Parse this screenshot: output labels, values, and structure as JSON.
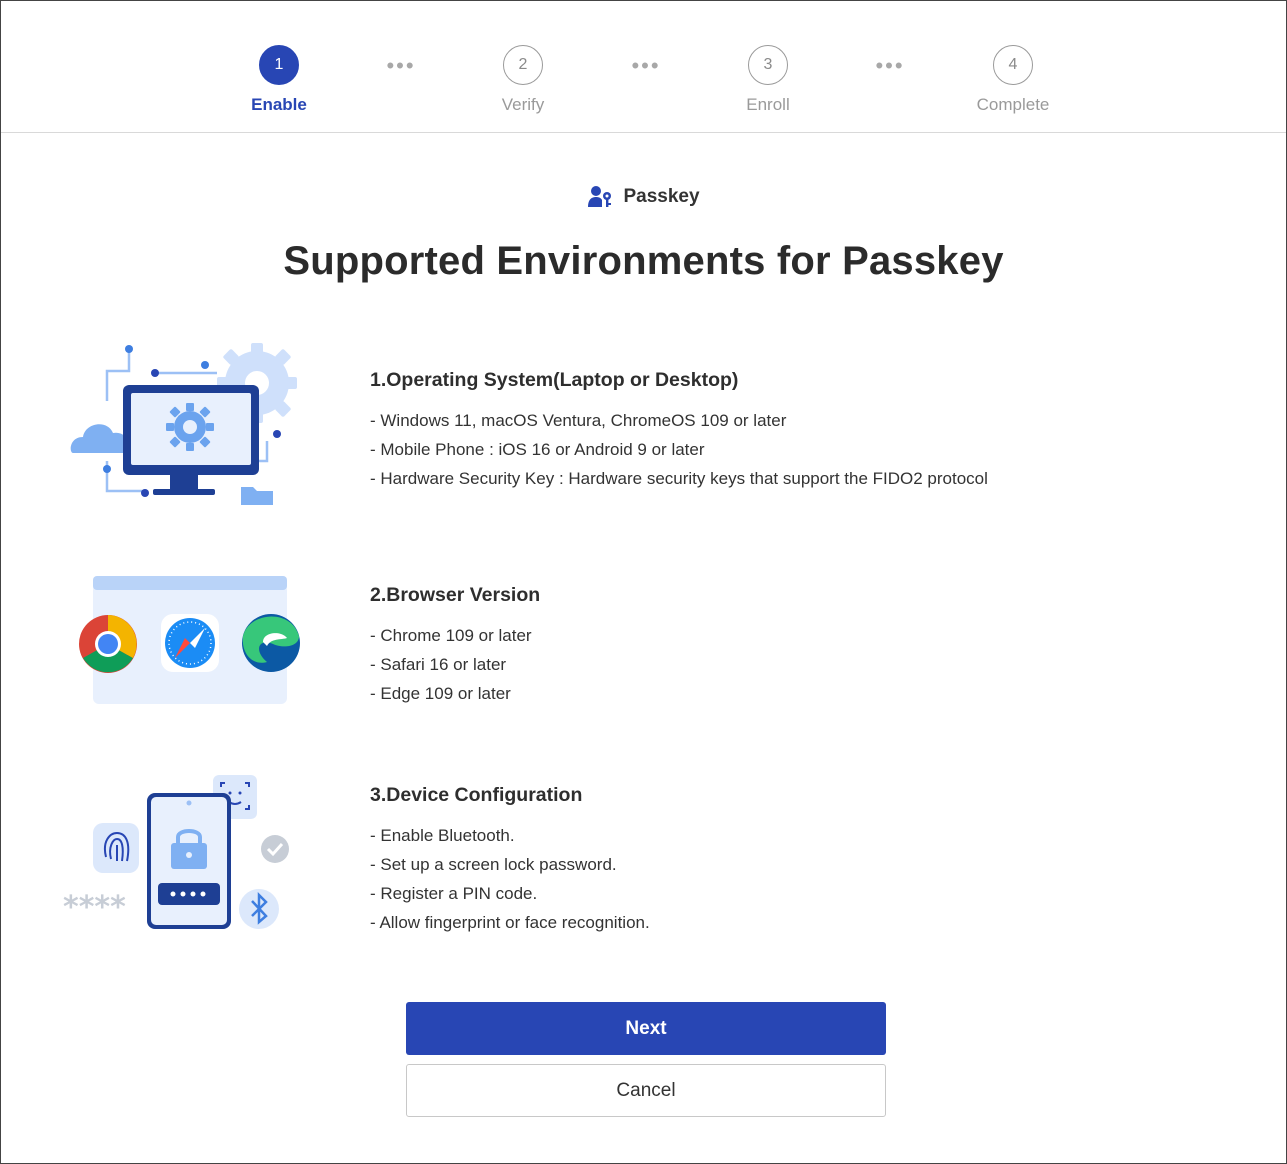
{
  "stepper": {
    "steps": [
      {
        "number": "1",
        "label": "Enable"
      },
      {
        "number": "2",
        "label": "Verify"
      },
      {
        "number": "3",
        "label": "Enroll"
      },
      {
        "number": "4",
        "label": "Complete"
      }
    ],
    "active_step": 1,
    "separator": "•••"
  },
  "header": {
    "kicker_icon": "passkey-user-key-icon",
    "kicker_label": "Passkey",
    "title": "Supported Environments for Passkey"
  },
  "sections": [
    {
      "illustration": "computer-gear-illustration",
      "title": "1.Operating System(Laptop or Desktop)",
      "items": [
        "- Windows 11, macOS Ventura, ChromeOS 109 or later",
        "- Mobile Phone : iOS 16 or Android 9 or later",
        "- Hardware Security Key : Hardware security keys that support the FIDO2 protocol"
      ]
    },
    {
      "illustration": "browsers-illustration",
      "title": "2.Browser Version",
      "items": [
        "- Chrome 109 or later",
        "- Safari 16 or later",
        "- Edge 109 or later"
      ]
    },
    {
      "illustration": "device-lock-illustration",
      "title": "3.Device Configuration",
      "items": [
        "- Enable Bluetooth.",
        "- Set up a screen lock password.",
        "- Register a PIN code.",
        "- Allow fingerprint or face recognition."
      ]
    }
  ],
  "actions": {
    "next_label": "Next",
    "cancel_label": "Cancel"
  },
  "colors": {
    "primary": "#2846b4",
    "muted": "#9a9a9a",
    "illustration_light": "#dce8fb",
    "illustration_accent": "#4a90e2"
  }
}
